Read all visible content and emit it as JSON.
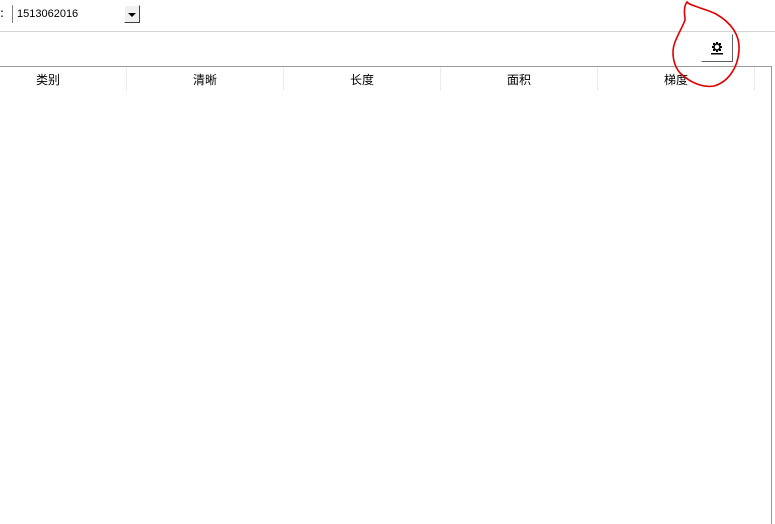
{
  "toolbar": {
    "prefix": ":",
    "combo_value": "1513062016"
  },
  "table": {
    "columns": [
      "类别",
      "清晰",
      "长度",
      "面积",
      "梯度"
    ]
  },
  "icons": {
    "settings": "gear-icon",
    "dropdown": "chevron-down-icon"
  },
  "colors": {
    "annotation": "#e00000",
    "border": "#9a9a9a"
  }
}
